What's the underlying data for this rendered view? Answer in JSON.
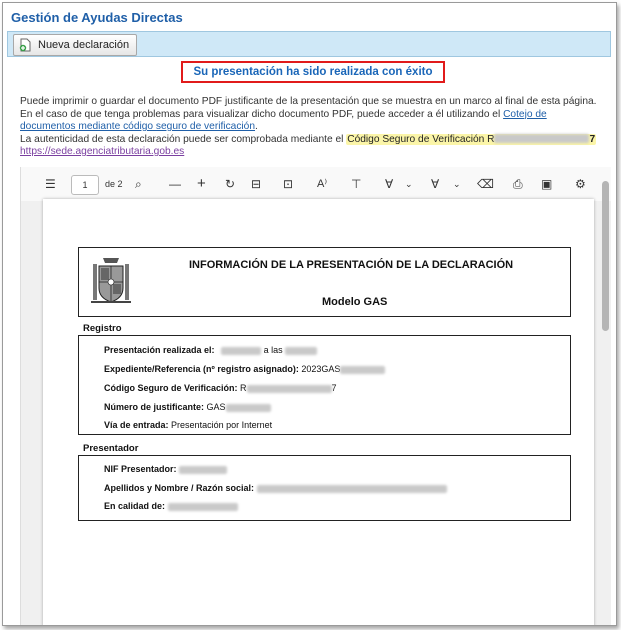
{
  "app": {
    "title": "Gestión de Ayudas Directas"
  },
  "toolbar": {
    "new_declaration_label": "Nueva declaración"
  },
  "status": {
    "success_message": "Su presentación ha sido realizada con éxito"
  },
  "info": {
    "line1": "Puede imprimir o guardar el documento PDF justificante de la presentación que se muestra en un marco al final de esta página.",
    "line2_pre": "En el caso de que tenga problemas para  visualizar dicho documento PDF, puede acceder a él utilizando el ",
    "link_cotejo": "Cotejo de documentos mediante código seguro de verificación",
    "line2_post": ".",
    "line3_pre": "La autenticidad de esta declaración puede ser comprobada mediante el ",
    "csv_label": "Código Seguro de Verificación R",
    "csv_tail": "7",
    "link_sede": "https://sede.agenciatributaria.gob.es"
  },
  "viewer": {
    "page_current": "1",
    "page_total": "de 2",
    "tools": [
      "menu-icon",
      "search-icon",
      "zoom-out-icon",
      "zoom-in-icon",
      "rotate-icon",
      "fit-icon",
      "view-icon",
      "read-aloud-icon",
      "text-icon",
      "draw-icon",
      "highlight-icon",
      "erase-icon",
      "print-icon",
      "save-icon",
      "settings-icon"
    ]
  },
  "document": {
    "title": "INFORMACIÓN DE LA PRESENTACIÓN DE LA DECLARACIÓN",
    "model": "Modelo GAS",
    "registro": {
      "section": "Registro",
      "presentacion_label": "Presentación realizada el:",
      "presentacion_mid": "a las",
      "expediente_label": "Expediente/Referencia (nº registro asignado):",
      "expediente_value": "2023GAS",
      "csv_label": "Código Seguro de Verificación:",
      "csv_value_start": "R",
      "csv_value_end": "7",
      "justificante_label": "Número de justificante:",
      "justificante_value": "GAS",
      "via_label": "Vía de entrada:",
      "via_value": "Presentación por Internet"
    },
    "presentador": {
      "section": "Presentador",
      "nif_label": "NIF Presentador:",
      "nombre_label": "Apellidos y Nombre / Razón social:",
      "calidad_label": "En calidad de:"
    }
  }
}
